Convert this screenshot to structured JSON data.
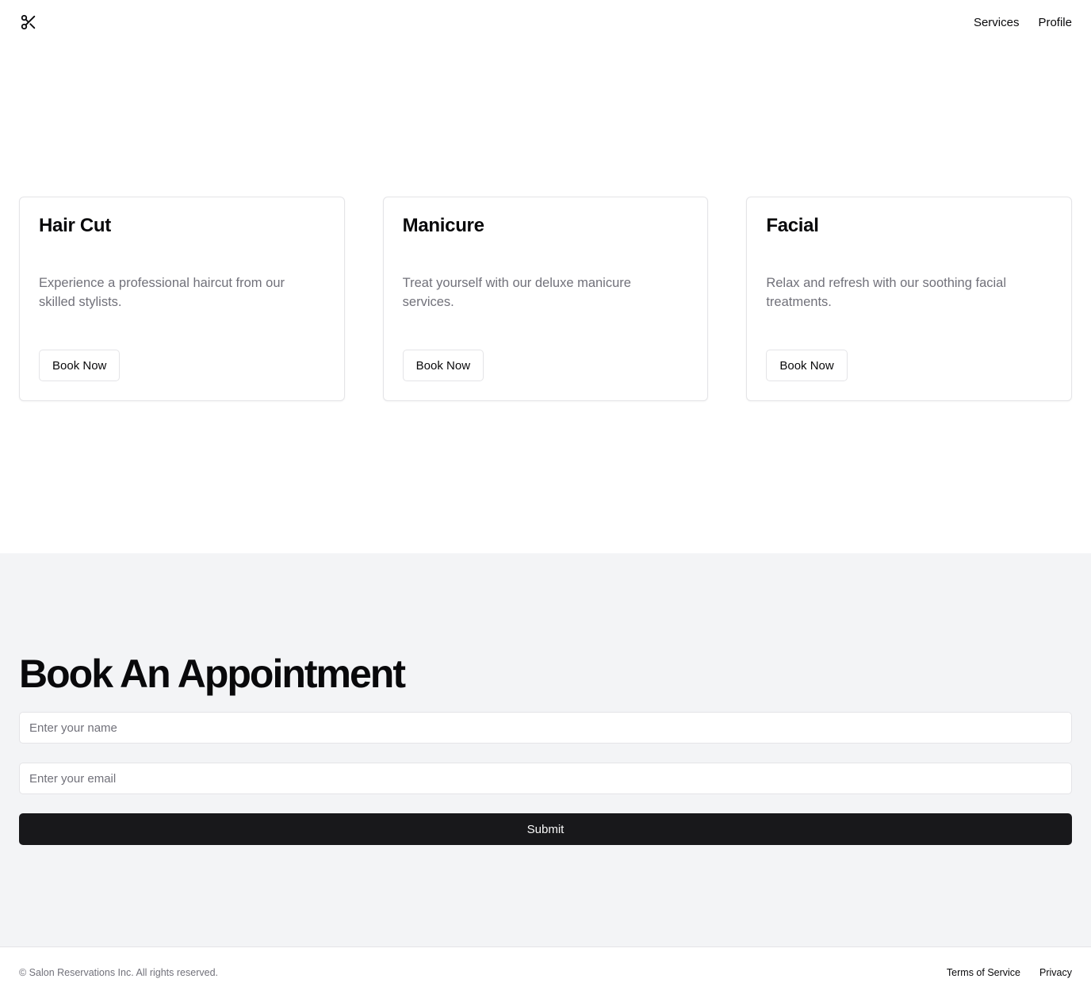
{
  "header": {
    "logo_icon": "scissors-icon",
    "nav": [
      {
        "label": "Services"
      },
      {
        "label": "Profile"
      }
    ]
  },
  "services": [
    {
      "title": "Hair Cut",
      "description": "Experience a professional haircut from our skilled stylists.",
      "button": "Book Now"
    },
    {
      "title": "Manicure",
      "description": "Treat yourself with our deluxe manicure services.",
      "button": "Book Now"
    },
    {
      "title": "Facial",
      "description": "Relax and refresh with our soothing facial treatments.",
      "button": "Book Now"
    }
  ],
  "booking": {
    "title": "Book An Appointment",
    "name_placeholder": "Enter your name",
    "email_placeholder": "Enter your email",
    "submit_label": "Submit"
  },
  "footer": {
    "copyright": "© Salon Reservations Inc. All rights reserved.",
    "links": [
      {
        "label": "Terms of Service"
      },
      {
        "label": "Privacy"
      }
    ]
  },
  "colors": {
    "background": "#ffffff",
    "section_bg": "#f3f4f6",
    "primary": "#18181b",
    "muted_text": "#71717a",
    "border": "#e4e4e7"
  }
}
